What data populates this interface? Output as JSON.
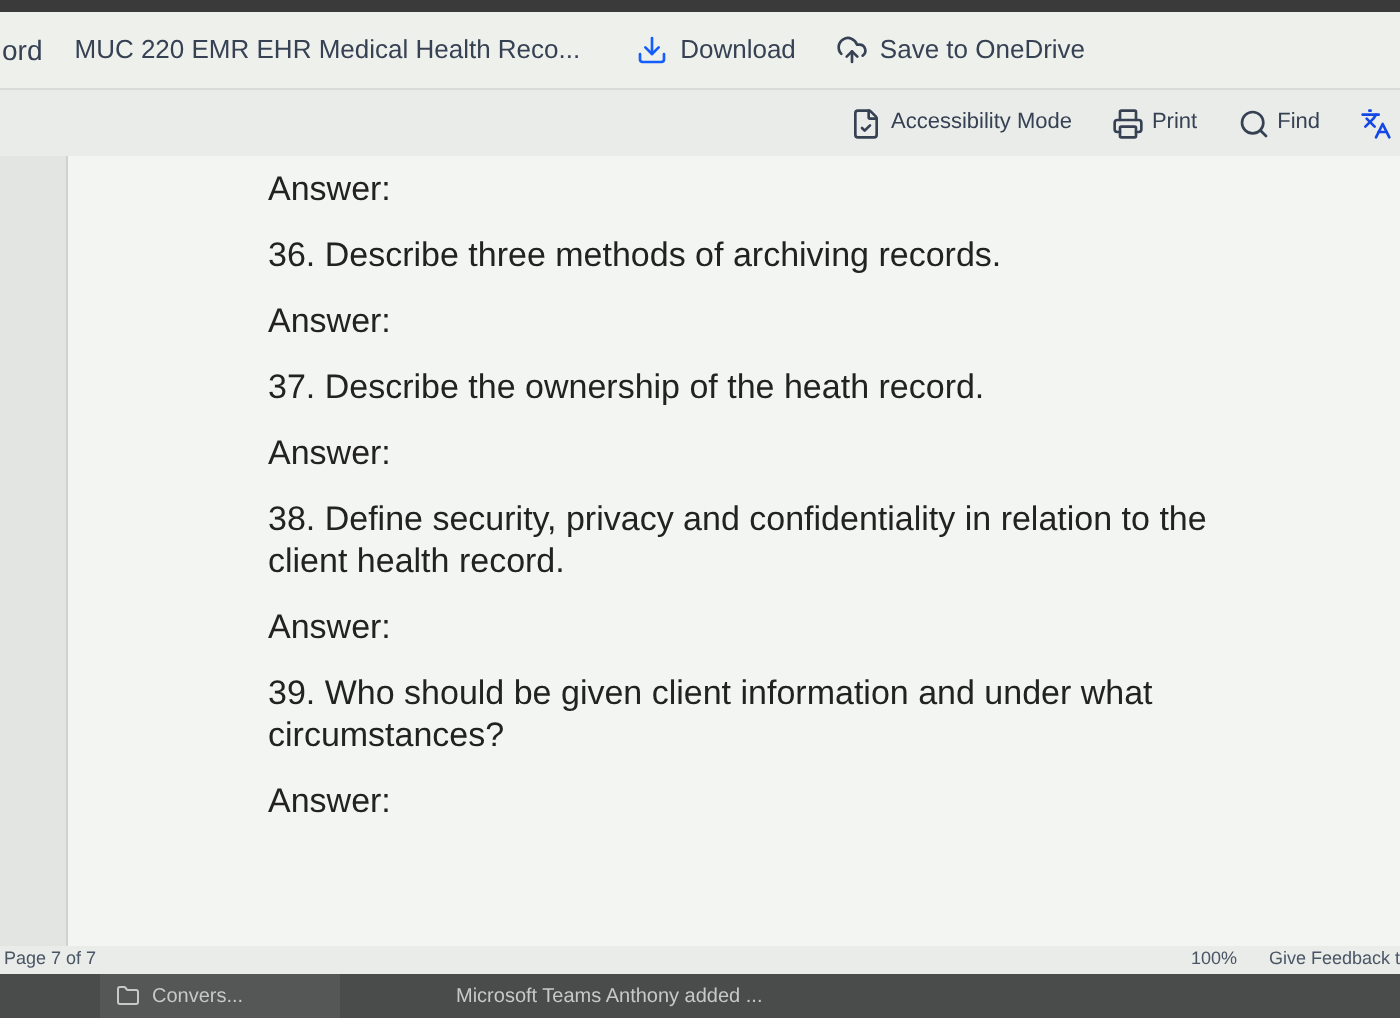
{
  "header": {
    "app": "ord",
    "title": "MUC 220 EMR EHR Medical Health Reco...",
    "download": "Download",
    "onedrive": "Save to OneDrive"
  },
  "toolbar": [
    {
      "kind": "accessibility",
      "label": "Accessibility Mode"
    },
    {
      "kind": "print",
      "label": "Print"
    },
    {
      "kind": "find",
      "label": "Find"
    },
    {
      "kind": "translate"
    }
  ],
  "document": [
    {
      "text": "Answer:"
    },
    {
      "text": "36. Describe three methods of archiving records."
    },
    {
      "text": "Answer:"
    },
    {
      "text": "37. Describe the ownership of the heath record."
    },
    {
      "text": "Answer:"
    },
    {
      "text": "38. Define security, privacy and confidentiality in relation to the client health record."
    },
    {
      "text": "Answer:"
    },
    {
      "text": "39. Who should be given client information and under what circumstances?"
    },
    {
      "text": "Answer:"
    }
  ],
  "status_bar": {
    "page": "Page 7 of 7",
    "zoom": "100%",
    "feedback": "Give Feedback t"
  },
  "taskbar": [
    {
      "kind": "folder",
      "label": "Convers..."
    },
    {
      "kind": "plain",
      "label": "Microsoft Teams Anthony added ..."
    }
  ]
}
